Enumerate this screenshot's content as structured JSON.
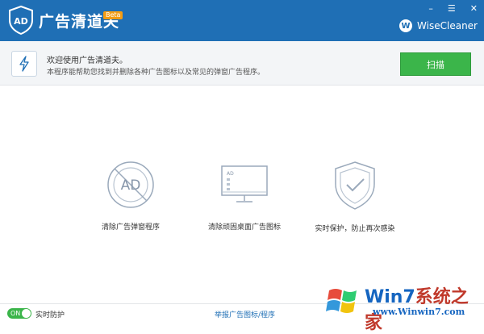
{
  "titlebar": {
    "app_title": "广告清道夫",
    "beta_badge": "Beta",
    "minimize_glyph": "–",
    "menu_glyph": "☰",
    "close_glyph": "✕",
    "brand_initial": "W",
    "brand_name": "WiseCleaner"
  },
  "info": {
    "welcome": "欢迎使用广告清道夫。",
    "description": "本程序能帮助您找到并删除各种广告图标以及常见的弹窗广告程序。",
    "scan_label": "扫描"
  },
  "features": [
    {
      "label": "清除广告弹窗程序",
      "icon": "ad-block-icon",
      "icon_text": "AD"
    },
    {
      "label": "清除顽固桌面广告图标",
      "icon": "monitor-icon",
      "icon_text": "AD"
    },
    {
      "label": "实时保护，防止再次感染",
      "icon": "shield-check-icon"
    }
  ],
  "bottom": {
    "toggle_text": "ON",
    "realtime_label": "实时防护",
    "report_link": "举报广告图标/程序"
  },
  "watermark": {
    "title_main": "Win7",
    "title_sub": "系统之家",
    "url": "www.Winwin7.com"
  },
  "colors": {
    "titlebar": "#1f6fb5",
    "scan_button": "#3bb54a",
    "icon_stroke": "#9aa9bb"
  }
}
